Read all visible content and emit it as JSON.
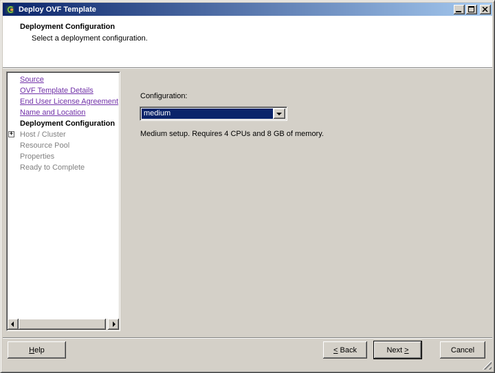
{
  "window": {
    "title": "Deploy OVF Template"
  },
  "header": {
    "title": "Deployment Configuration",
    "subtitle": "Select a deployment configuration."
  },
  "sidebar": {
    "items": [
      {
        "label": "Source",
        "state": "completed-link"
      },
      {
        "label": "OVF Template Details",
        "state": "completed-link"
      },
      {
        "label": "End User License Agreement",
        "state": "completed-link"
      },
      {
        "label": "Name and Location",
        "state": "completed-link"
      },
      {
        "label": "Deployment Configuration",
        "state": "current"
      },
      {
        "label": "Host / Cluster",
        "state": "disabled",
        "expander": "+"
      },
      {
        "label": "Resource Pool",
        "state": "disabled"
      },
      {
        "label": "Properties",
        "state": "disabled"
      },
      {
        "label": "Ready to Complete",
        "state": "disabled"
      }
    ]
  },
  "content": {
    "configuration_label": "Configuration:",
    "configuration_value": "medium",
    "description": "Medium setup. Requires 4 CPUs and 8 GB of memory."
  },
  "footer": {
    "help": {
      "pre": "",
      "accel": "H",
      "post": "elp"
    },
    "back": {
      "pre": "",
      "accel": "<",
      "post": " Back"
    },
    "next": {
      "pre": "Next ",
      "accel": ">",
      "post": ""
    },
    "cancel": {
      "pre": "Cancel",
      "accel": "",
      "post": ""
    }
  },
  "icons": {
    "app_icon": "ovf-package",
    "minimize_icon": "underscore-bar",
    "maximize_icon": "window-outline",
    "close_icon": "x-cross",
    "dropdown_icon": "triangle-down",
    "scroll_left_icon": "triangle-left",
    "scroll_right_icon": "triangle-right",
    "expander_icon": "plus-box",
    "resize_grip_icon": "diagonal-lines"
  },
  "colors": {
    "titlebar_start": "#0A246A",
    "titlebar_end": "#A6CAF0",
    "dialog_bg": "#D4D0C8",
    "panel_white": "#FFFFFF",
    "link_purple": "#7030A8",
    "selection_navy": "#0A246A",
    "disabled_gray": "#808080",
    "text_black": "#000000"
  }
}
